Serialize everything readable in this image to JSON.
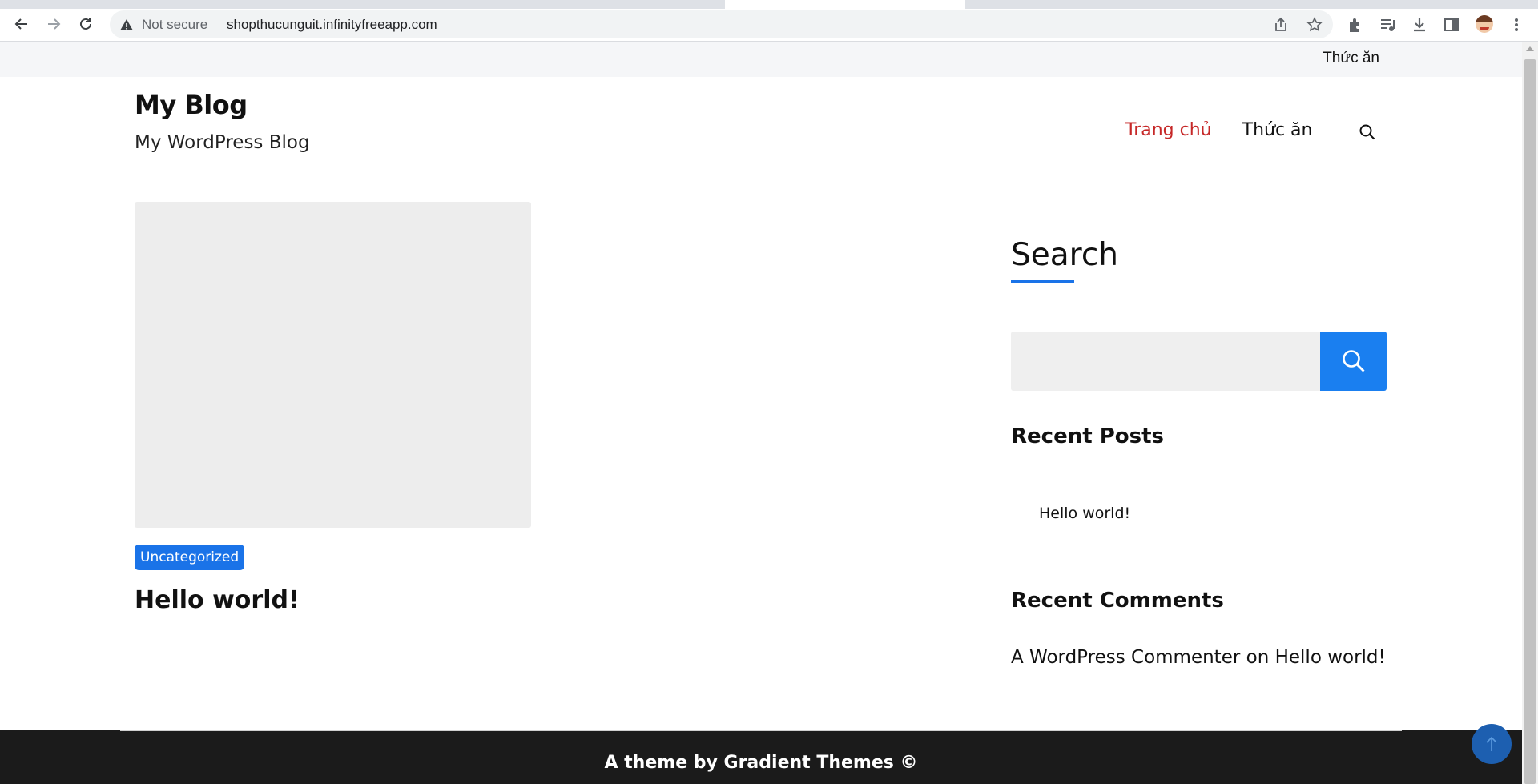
{
  "browser": {
    "security_label": "Not secure",
    "url": "shopthucunguit.infinityfreeapp.com"
  },
  "topbar": {
    "link": "Thức ăn"
  },
  "header": {
    "site_title": "My Blog",
    "site_description": "My WordPress Blog",
    "nav": [
      {
        "label": "Trang chủ",
        "active": true
      },
      {
        "label": "Thức ăn",
        "active": false
      }
    ]
  },
  "post": {
    "category": "Uncategorized",
    "title": "Hello world!"
  },
  "sidebar": {
    "search_title": "Search",
    "search_input_value": "",
    "recent_posts_title": "Recent Posts",
    "recent_posts": [
      "Hello world!"
    ],
    "recent_comments_title": "Recent Comments",
    "recent_comment": {
      "author": "A WordPress Commenter",
      "connector": "on",
      "post": "Hello world!"
    }
  },
  "footer": {
    "text": "A theme by Gradient Themes ©"
  },
  "colors": {
    "accent": "#1a73e8",
    "active_nav": "#c62828",
    "footer_bg": "#1b1b1b"
  }
}
